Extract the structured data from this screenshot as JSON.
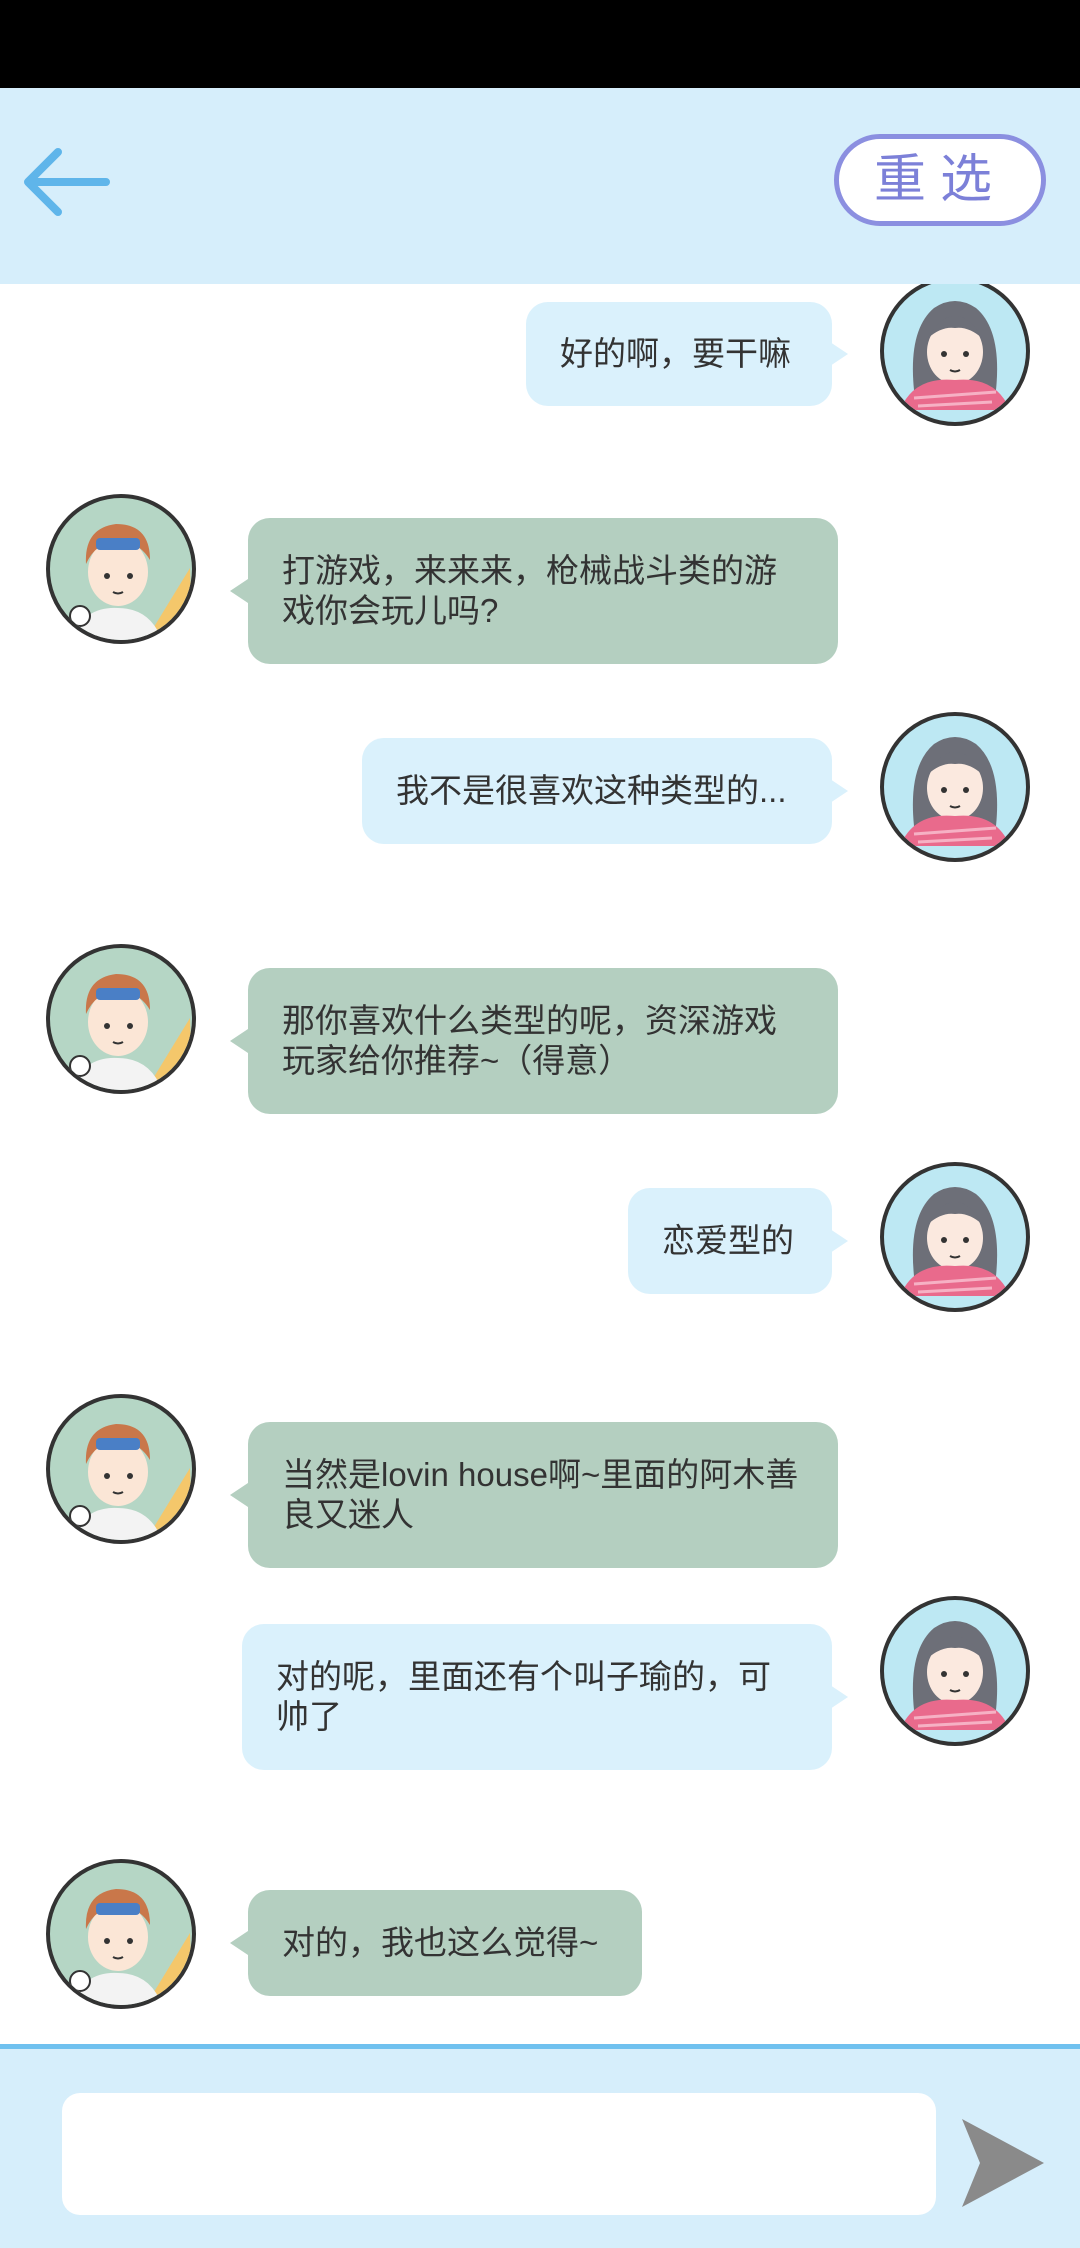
{
  "header": {
    "back_icon": "arrow-left-icon",
    "reselect_label": "重选"
  },
  "messages": [
    {
      "sender": "me",
      "text": "好的啊，要干嘛"
    },
    {
      "sender": "them",
      "text": "打游戏，来来来，枪械战斗类的游戏你会玩儿吗?"
    },
    {
      "sender": "me",
      "text": "我不是很喜欢这种类型的..."
    },
    {
      "sender": "them",
      "text": "那你喜欢什么类型的呢，资深游戏玩家给你推荐~（得意）"
    },
    {
      "sender": "me",
      "text": "恋爱型的"
    },
    {
      "sender": "them",
      "text": "当然是lovin house啊~里面的阿木善良又迷人"
    },
    {
      "sender": "me",
      "text": "对的呢，里面还有个叫子瑜的，可帅了"
    },
    {
      "sender": "them",
      "text": "对的，我也这么觉得~"
    }
  ],
  "composer": {
    "placeholder": "",
    "send_icon": "send-arrow-icon"
  },
  "colors": {
    "bar_bg": "#d6eefb",
    "my_bubble": "#daf1fc",
    "their_bubble": "#b4cfc0",
    "accent_blue": "#6fc1ef",
    "reselect": "#7c80d8"
  }
}
